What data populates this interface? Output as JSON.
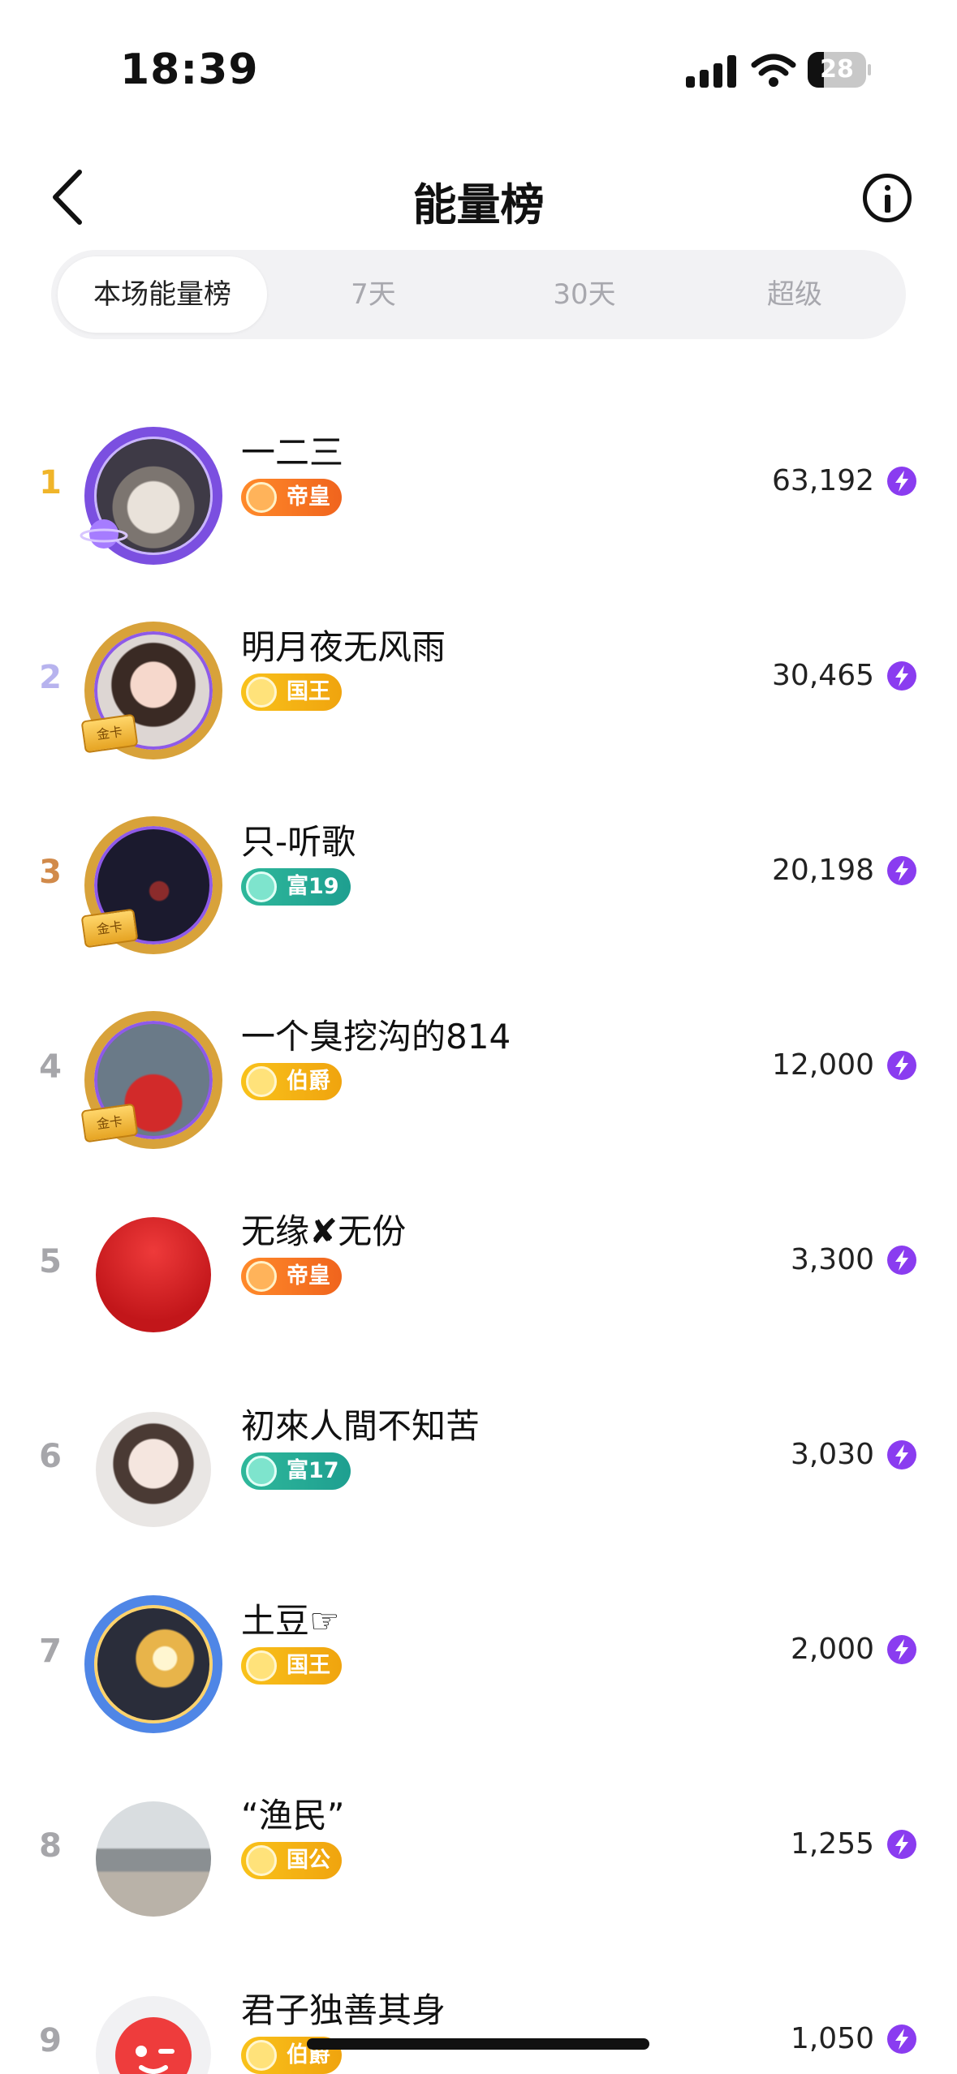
{
  "status": {
    "time": "18:39",
    "battery": "28",
    "battery_fraction": 0.28
  },
  "nav": {
    "title": "能量榜",
    "back_icon": "chevron-left-icon",
    "info_icon": "info-icon"
  },
  "tabs": [
    {
      "label": "本场能量榜",
      "active": true
    },
    {
      "label": "7天",
      "active": false
    },
    {
      "label": "30天",
      "active": false
    },
    {
      "label": "超级",
      "active": false
    }
  ],
  "colors": {
    "rank_1": "#f0b52a",
    "rank_2": "#b7b3ee",
    "rank_3": "#d18a4a",
    "rank_other": "#a6a6aa",
    "energy_icon": "#8a3cf0"
  },
  "ranking": [
    {
      "rank": "1",
      "name": "一二三",
      "badge": "帝皇",
      "badge_style": "emperor",
      "score": "63,192",
      "frame": "purple",
      "avatar": "photo-room"
    },
    {
      "rank": "2",
      "name": "明月夜无风雨",
      "badge": "国王",
      "badge_style": "gold",
      "score": "30,465",
      "frame": "gold-card",
      "card_label": "金卡",
      "avatar": "photo-girl"
    },
    {
      "rank": "3",
      "name": "只-听歌",
      "badge": "富19",
      "badge_style": "teal",
      "score": "20,198",
      "frame": "gold-card",
      "card_label": "金卡",
      "avatar": "photo-dark"
    },
    {
      "rank": "4",
      "name": "一个臭挖沟的814",
      "badge": "伯爵",
      "badge_style": "gold",
      "score": "12,000",
      "frame": "gold-card",
      "card_label": "金卡",
      "avatar": "photo-player"
    },
    {
      "rank": "5",
      "name": "无缘✘无份",
      "badge": "帝皇",
      "badge_style": "emperor",
      "score": "3,300",
      "frame": "none",
      "avatar": "red-circle"
    },
    {
      "rank": "6",
      "name": "初來人間不知苦",
      "badge": "富17",
      "badge_style": "teal",
      "score": "3,030",
      "frame": "none",
      "avatar": "photo-woman"
    },
    {
      "rank": "7",
      "name": "土豆☞",
      "badge": "国王",
      "badge_style": "gold",
      "score": "2,000",
      "frame": "blue",
      "avatar": "photo-climb"
    },
    {
      "rank": "8",
      "name": "“渔民”",
      "badge": "国公",
      "badge_style": "gold",
      "score": "1,255",
      "frame": "none",
      "avatar": "photo-harbor"
    },
    {
      "rank": "9",
      "name": "君子独善其身",
      "badge": "伯爵",
      "badge_style": "gold",
      "score": "1,050",
      "frame": "none",
      "avatar": "red-wink"
    }
  ]
}
